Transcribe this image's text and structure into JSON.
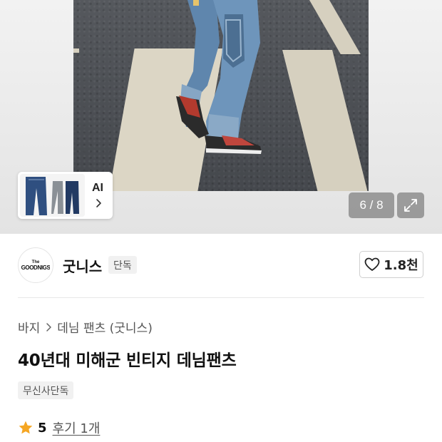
{
  "gallery": {
    "thumbnail_label": "AI",
    "counter": "6 / 8",
    "icons": [
      "chevron-right-icon",
      "expand-icon"
    ]
  },
  "brand": {
    "logo_text": "The GOODNIGS",
    "name": "굿니스",
    "badge": "단독",
    "like_count": "1.8천",
    "icons": [
      "heart-icon"
    ]
  },
  "breadcrumb": {
    "items": [
      "바지",
      "데님 팬츠 (굿니스)"
    ]
  },
  "product": {
    "title": "40년대 미해군 빈티지 데님팬츠",
    "tag": "무신사단독"
  },
  "rating": {
    "score": "5",
    "review_link": "후기 1개",
    "star_color": "#f5a623"
  }
}
